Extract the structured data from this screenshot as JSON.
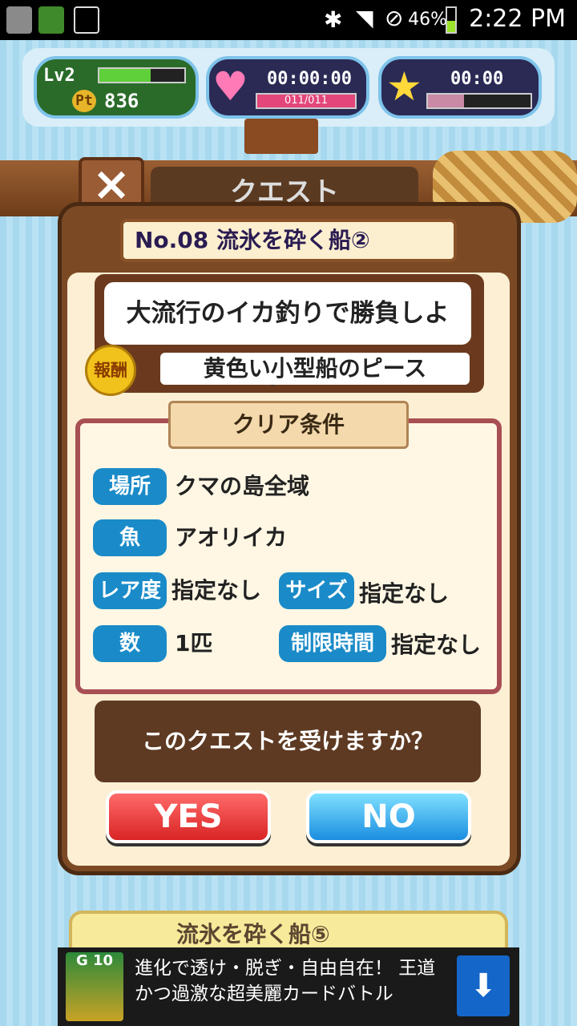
{
  "status_bar": {
    "battery": "46%",
    "time": "2:22 PM"
  },
  "hud": {
    "level": "Lv2",
    "pt_label": "Pt",
    "points": "836",
    "heart_timer": "00:00:00",
    "heart_count": "011/011",
    "star_timer": "00:00",
    "level_progress": 0.6,
    "star_progress": 0.35
  },
  "header": {
    "close_label": "×",
    "title": "クエスト"
  },
  "quest": {
    "number_title": "No.08 流氷を砕く船②",
    "subtitle": "大流行のイカ釣りで勝負しよう！",
    "reward_badge": "報酬",
    "reward": "黄色い小型船のピース",
    "conditions_title": "クリア条件",
    "conditions": {
      "place_label": "場所",
      "place": "クマの島全域",
      "fish_label": "魚",
      "fish": "アオリイカ",
      "rarity_label": "レア度",
      "rarity": "指定なし",
      "size_label": "サイズ",
      "size": "指定なし",
      "count_label": "数",
      "count": "1匹",
      "time_label": "制限時間",
      "time": "指定なし"
    },
    "question": "このクエストを受けますか？",
    "yes": "YES",
    "no": "NO"
  },
  "under_card": {
    "text": "流氷を砕く船⑤"
  },
  "ad": {
    "badge": "G 10",
    "line1": "進化で透け・脱ぎ・自由自在！ 王道",
    "line2": "かつ過激な超美麗カードバトル"
  }
}
